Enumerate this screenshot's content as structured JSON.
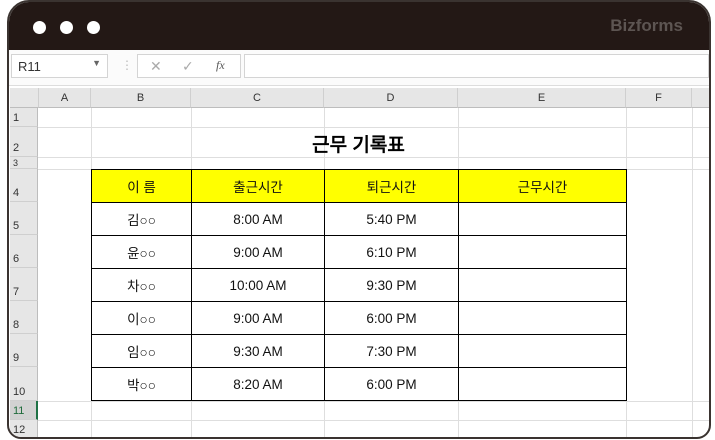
{
  "brand": "Bizforms",
  "name_box": "R11",
  "formula_icons": {
    "cancel": "✕",
    "enter": "✓",
    "fx": "fx"
  },
  "columns": [
    "A",
    "B",
    "C",
    "D",
    "E",
    "F"
  ],
  "rows": [
    "1",
    "2",
    "3",
    "4",
    "5",
    "6",
    "7",
    "8",
    "9",
    "10",
    "11",
    "12"
  ],
  "sheet_title": "근무 기록표",
  "table": {
    "headers": [
      "이 름",
      "출근시간",
      "퇴근시간",
      "근무시간"
    ],
    "rows": [
      [
        "김○○",
        "8:00 AM",
        "5:40 PM",
        ""
      ],
      [
        "윤○○",
        "9:00 AM",
        "6:10 PM",
        ""
      ],
      [
        "차○○",
        "10:00 AM",
        "9:30 PM",
        ""
      ],
      [
        "이○○",
        "9:00 AM",
        "6:00 PM",
        ""
      ],
      [
        "임○○",
        "9:30 AM",
        "7:30 PM",
        ""
      ],
      [
        "박○○",
        "8:20 AM",
        "6:00 PM",
        ""
      ]
    ]
  }
}
